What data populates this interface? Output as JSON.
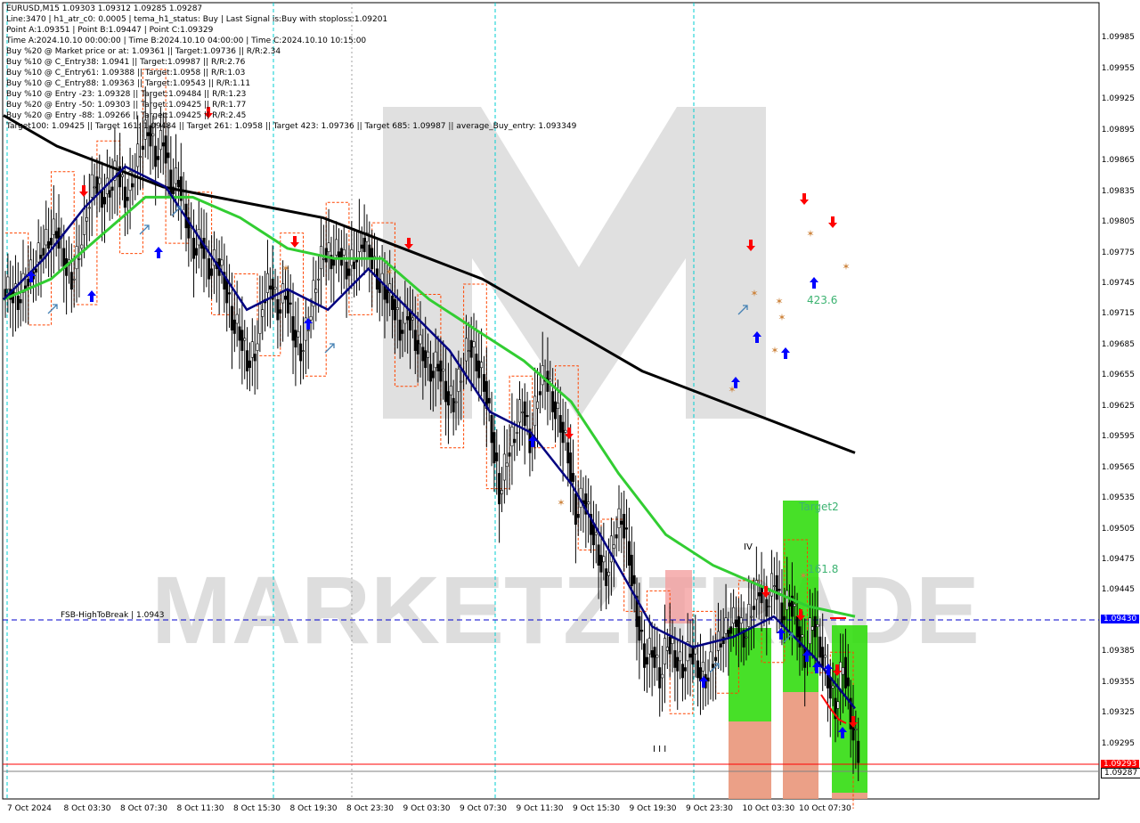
{
  "header": {
    "symbol_line": "EURUSD,M15  1.09303 1.09312 1.09285 1.09287",
    "info_lines": [
      "Line:3470  |  h1_atr_c0: 0.0005  |  tema_h1_status: Buy  |  Last Signal is:Buy with stoploss:1.09201",
      "Point A:1.09351  |  Point B:1.09447  |  Point C:1.09329",
      "Time A:2024.10.10 00:00:00  |  Time B:2024.10.10 04:00:00  |  Time C:2024.10.10 10:15:00",
      "Buy %20 @ Market price or at: 1.09361  ||  Target:1.09736  ||  R/R:2.34",
      "Buy %10 @ C_Entry38: 1.0941  ||  Target:1.09987  ||  R/R:2.76",
      "Buy %10 @ C_Entry61: 1.09388  ||  Target:1.0958  ||  R/R:1.03",
      "Buy %10 @ C_Entry88: 1.09363  ||  Target:1.09543  ||  R/R:1.11",
      "Buy %10 @ Entry -23: 1.09328  ||  Target:1.09484  ||  R/R:1.23",
      "Buy %20 @ Entry -50: 1.09303  ||  Target:1.09425  ||  R/R:1.77",
      "Buy %20 @ Entry -88: 1.09266  ||  Target:1.09425  ||  R/R:2.45",
      "Target100: 1.09425  ||  Target 161: 1.09484  ||  Target 261: 1.0958  ||  Target 423: 1.09736  ||  Target 685: 1.09987  ||  average_Buy_entry: 1.093349"
    ]
  },
  "watermark": "MARKETZITRADE",
  "annotations": {
    "fsb_label": "FSB-HighToBreak  |  1.0943",
    "target2": "Target2",
    "fib_161": "161.8",
    "fib_423": "423.6",
    "wave_iv": "IV",
    "wave_iii": "I I I"
  },
  "colors": {
    "background": "#ffffff",
    "candle": "#000000",
    "ema_black": "#000000",
    "ma_green": "#32cd32",
    "tema_navy": "#000080",
    "stop_line": "#ff4500",
    "buy_arrow": "#0000ff",
    "sell_arrow": "#ff0000",
    "fsb_line": "#0000cd",
    "cyan_vline": "#00ced1",
    "zone_green": "#33dd11",
    "zone_orange": "#e9967a",
    "zone_pink": "#f4a0a0"
  },
  "chart_data": {
    "type": "candlestick",
    "title": "EURUSD,M15",
    "ylim": [
      1.09245,
      1.09995
    ],
    "y_ticks": [
      "1.09985",
      "1.09955",
      "1.09925",
      "1.09895",
      "1.09865",
      "1.09835",
      "1.09805",
      "1.09775",
      "1.09745",
      "1.09715",
      "1.09685",
      "1.09655",
      "1.09625",
      "1.09595",
      "1.09565",
      "1.09535",
      "1.09505",
      "1.09475",
      "1.09445",
      "1.09415",
      "1.09385",
      "1.09355",
      "1.09325",
      "1.09295",
      "1.09265"
    ],
    "x_labels": [
      "7 Oct 2024",
      "8 Oct 03:30",
      "8 Oct 07:30",
      "8 Oct 11:30",
      "8 Oct 15:30",
      "8 Oct 19:30",
      "8 Oct 23:30",
      "9 Oct 03:30",
      "9 Oct 07:30",
      "9 Oct 11:30",
      "9 Oct 15:30",
      "9 Oct 19:30",
      "9 Oct 23:30",
      "10 Oct 03:30",
      "10 Oct 07:30"
    ],
    "last_price": 1.09287,
    "price_tags": {
      "fsb": "1.09430",
      "red_level": "1.09293",
      "current": "1.09287"
    },
    "levels": {
      "fsb_high_to_break": 1.0943,
      "red_line": 1.09293
    },
    "series": [
      {
        "name": "price_close",
        "values": [
          1.0974,
          1.0973,
          1.0975,
          1.0976,
          1.0978,
          1.0979,
          1.098,
          1.0977,
          1.0975,
          1.0978,
          1.0982,
          1.0985,
          1.0983,
          1.0984,
          1.0986,
          1.0983,
          1.0985,
          1.0988,
          1.099,
          1.0987,
          1.0989,
          1.0984,
          1.0985,
          1.0981,
          1.0978,
          1.0979,
          1.0976,
          1.0977,
          1.0975,
          1.0971,
          1.097,
          1.0967,
          1.0968,
          1.0973,
          1.0975,
          1.0972,
          1.0974,
          1.097,
          1.0968,
          1.0971,
          1.0975,
          1.0978,
          1.0977,
          1.0978,
          1.0976,
          1.0977,
          1.0979,
          1.0978,
          1.0975,
          1.0974,
          1.0973,
          1.097,
          1.0972,
          1.0969,
          1.0968,
          1.0966,
          1.0967,
          1.0964,
          1.0963,
          1.0966,
          1.0969,
          1.0967,
          1.0965,
          1.096,
          1.0954,
          1.0958,
          1.096,
          1.0963,
          1.0959,
          1.0964,
          1.0966,
          1.0963,
          1.0961,
          1.0958,
          1.0952,
          1.0954,
          1.0951,
          1.0948,
          1.0946,
          1.095,
          1.0952,
          1.0948,
          1.0942,
          1.0938,
          1.0939,
          1.0936,
          1.094,
          1.0938,
          1.0937,
          1.0939,
          1.0937,
          1.0936,
          1.0938,
          1.094,
          1.0941,
          1.0942,
          1.094,
          1.0943,
          1.0945,
          1.0943,
          1.0946,
          1.0942,
          1.0944,
          1.0941,
          1.0938,
          1.0942,
          1.0939,
          1.0936,
          1.0933,
          1.0938,
          1.0932,
          1.09287
        ]
      },
      {
        "name": "ema_black",
        "values": [
          1.0991,
          1.0988,
          1.0986,
          1.0984,
          1.0983,
          1.0982,
          1.0981,
          1.0979,
          1.0977,
          1.0975,
          1.0972,
          1.0969,
          1.0966,
          1.0964,
          1.0962,
          1.096,
          1.0958
        ]
      },
      {
        "name": "ma_green",
        "values": [
          1.0973,
          1.0975,
          1.0979,
          1.0983,
          1.0983,
          1.0981,
          1.0978,
          1.0977,
          1.0977,
          1.0973,
          1.097,
          1.0967,
          1.0963,
          1.0956,
          1.095,
          1.0947,
          1.0945,
          1.0943,
          1.0942
        ]
      },
      {
        "name": "tema_navy",
        "values": [
          1.0973,
          1.0977,
          1.0982,
          1.0986,
          1.0984,
          1.0978,
          1.0972,
          1.0974,
          1.0972,
          1.0976,
          1.0972,
          1.0968,
          1.0962,
          1.096,
          1.0955,
          1.0948,
          1.0941,
          1.0939,
          1.094,
          1.0942,
          1.0938,
          1.0933
        ]
      }
    ],
    "signals": {
      "buy_arrows": 18,
      "sell_arrows": 9
    }
  }
}
